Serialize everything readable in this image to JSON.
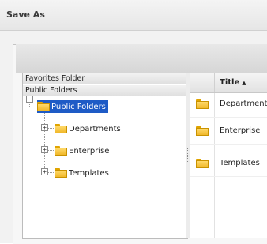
{
  "dialog": {
    "title": "Save As"
  },
  "left_pane": {
    "favorites_header": "Favorites Folder",
    "public_header": "Public Folders",
    "tree": {
      "root": {
        "label": "Public Folders",
        "expander": "−"
      },
      "children": [
        {
          "label": "Departments",
          "expander": "+"
        },
        {
          "label": "Enterprise",
          "expander": "+"
        },
        {
          "label": "Templates",
          "expander": "+"
        }
      ]
    }
  },
  "right_pane": {
    "columns": {
      "title": "Title",
      "sort_indicator": "▲"
    },
    "rows": [
      {
        "title": "Departments"
      },
      {
        "title": "Enterprise"
      },
      {
        "title": "Templates"
      }
    ]
  },
  "colors": {
    "selection": "#1e5bc6",
    "folder": "#f0b82a"
  }
}
